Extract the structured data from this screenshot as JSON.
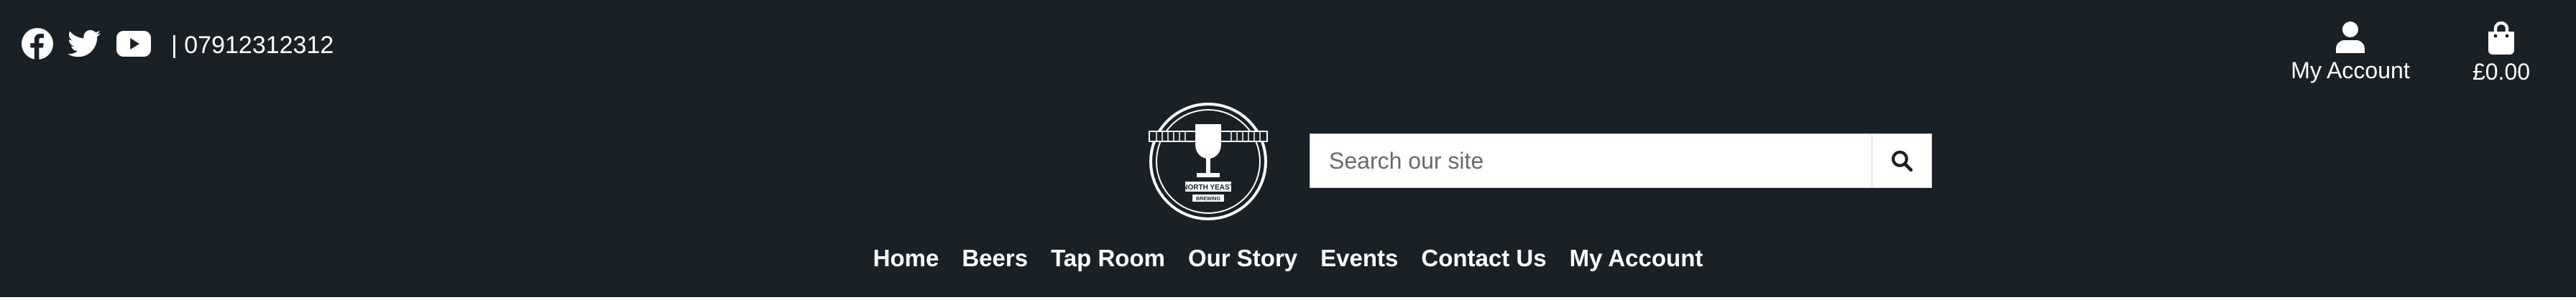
{
  "social": {
    "icons": [
      "facebook-icon",
      "twitter-icon",
      "youtube-icon"
    ],
    "phone": "| 07912312312"
  },
  "account": {
    "label": "My Account",
    "icon": "user-icon"
  },
  "basket": {
    "total": "£0.00",
    "icon": "shopping-bag-icon"
  },
  "logo": {
    "icon": "north-yeast-brewing-logo",
    "text_line1": "NORTH YEAST",
    "text_line2": "BREWING"
  },
  "search": {
    "placeholder": "Search our site",
    "icon": "search-icon"
  },
  "nav": {
    "items": [
      {
        "label": "Home"
      },
      {
        "label": "Beers"
      },
      {
        "label": "Tap Room"
      },
      {
        "label": "Our Story"
      },
      {
        "label": "Events"
      },
      {
        "label": "Contact Us"
      },
      {
        "label": "My Account"
      }
    ]
  },
  "colors": {
    "background": "#1a2126",
    "text": "#ffffff",
    "search_bg": "#ffffff"
  }
}
